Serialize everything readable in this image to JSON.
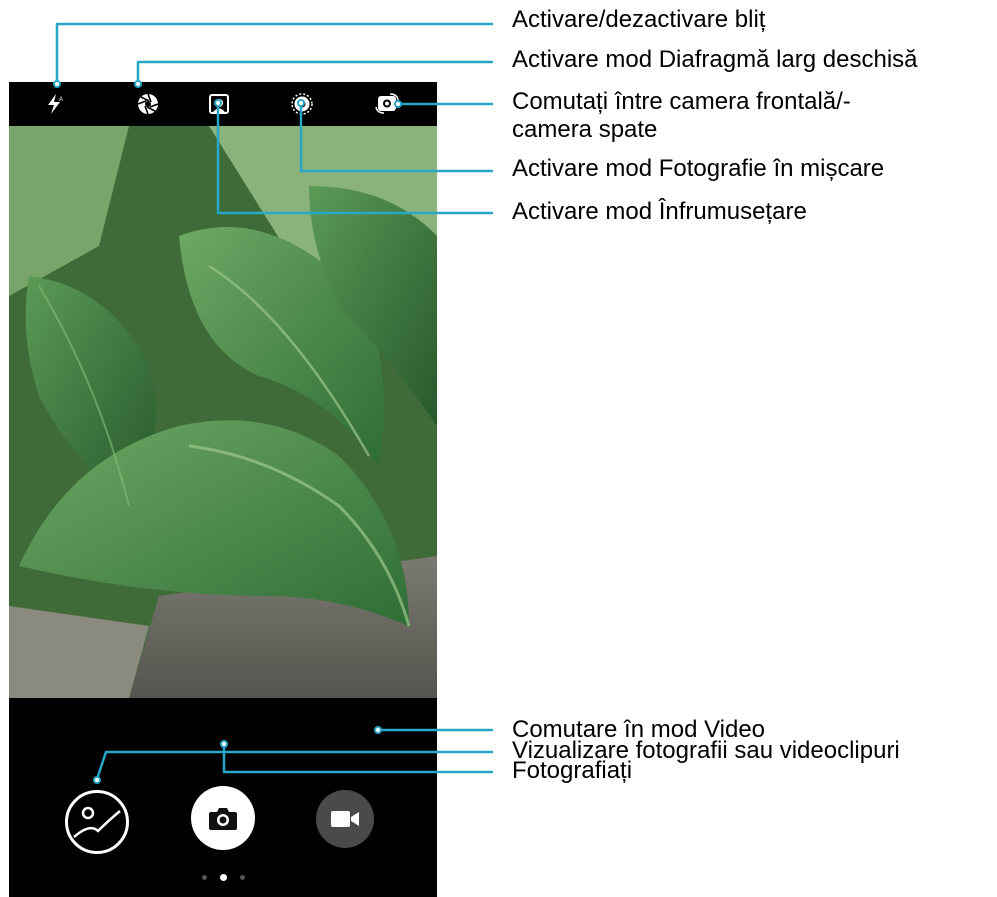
{
  "callouts": {
    "flash": "Activare/dezactivare bliț",
    "aperture": "Activare mod Diafragmă larg deschisă",
    "switch_camera_line1": "Comutați între camera frontală/-",
    "switch_camera_line2": "camera spate",
    "moving_picture": "Activare mod Fotografie în mișcare",
    "beauty": "Activare mod Înfrumusețare",
    "gallery": "Vizualizare fotografii sau videoclipuri",
    "video_mode": "Comutare în mod Video",
    "shutter": "Fotografiați"
  },
  "icons": {
    "flash": "flash-icon",
    "aperture": "aperture-icon",
    "beauty": "beauty-icon",
    "moving_picture": "moving-picture-icon",
    "switch_camera": "switch-camera-icon",
    "gallery": "gallery-icon",
    "shutter": "camera-icon",
    "video": "video-icon"
  },
  "colors": {
    "callout_line": "#29a7c8",
    "phone_bg": "#000000",
    "video_button_bg": "#4a4a4a"
  },
  "mode_pager": {
    "count": 3,
    "active_index": 1
  }
}
